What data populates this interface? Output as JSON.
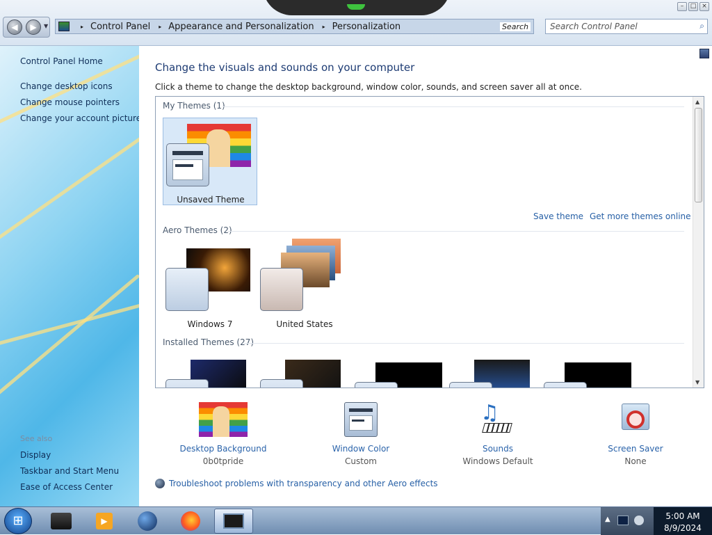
{
  "window": {
    "breadcrumb": [
      "Control Panel",
      "Appearance and Personalization",
      "Personalization"
    ],
    "address_search_label": "Search",
    "search_placeholder": "Search Control Panel",
    "buttons": [
      "minimize",
      "maximize",
      "close"
    ]
  },
  "sidebar": {
    "items": [
      {
        "label": "Control Panel Home"
      },
      {
        "label": "Change desktop icons"
      },
      {
        "label": "Change mouse pointers"
      },
      {
        "label": "Change your account picture"
      }
    ],
    "see_also_heading": "See also",
    "see_also": [
      {
        "label": "Display"
      },
      {
        "label": "Taskbar and Start Menu"
      },
      {
        "label": "Ease of Access Center"
      }
    ]
  },
  "main": {
    "heading": "Change the visuals and sounds on your computer",
    "subtitle": "Click a theme to change the desktop background, window color, sounds, and screen saver all at once.",
    "groups": {
      "my_themes": "My Themes (1)",
      "aero_themes": "Aero Themes (2)",
      "installed_themes": "Installed Themes (27)"
    },
    "my_themes_items": [
      {
        "label": "Unsaved Theme",
        "selected": true
      }
    ],
    "aero_items": [
      {
        "label": "Windows 7"
      },
      {
        "label": "United States"
      }
    ],
    "links": {
      "save_theme": "Save theme",
      "get_more": "Get more themes online"
    },
    "bottom": [
      {
        "label": "Desktop Background",
        "value": "0b0tpride",
        "icon": "rainbow-wallpaper-icon"
      },
      {
        "label": "Window Color",
        "value": "Custom",
        "icon": "window-color-icon"
      },
      {
        "label": "Sounds",
        "value": "Windows Default",
        "icon": "music-notes-icon"
      },
      {
        "label": "Screen Saver",
        "value": "None",
        "icon": "no-screensaver-icon"
      }
    ],
    "troubleshoot": "Troubleshoot problems with transparency and other Aero effects"
  },
  "taskbar": {
    "start_label": "Start",
    "apps": [
      "Desktop",
      "Windows Media Player",
      "Internet",
      "Firefox",
      "Personalization"
    ],
    "time": "5:00 AM",
    "date": "8/9/2024"
  },
  "colors": {
    "link": "#2760a6",
    "heading": "#1d3b73",
    "accent": "#4fb7e8"
  }
}
